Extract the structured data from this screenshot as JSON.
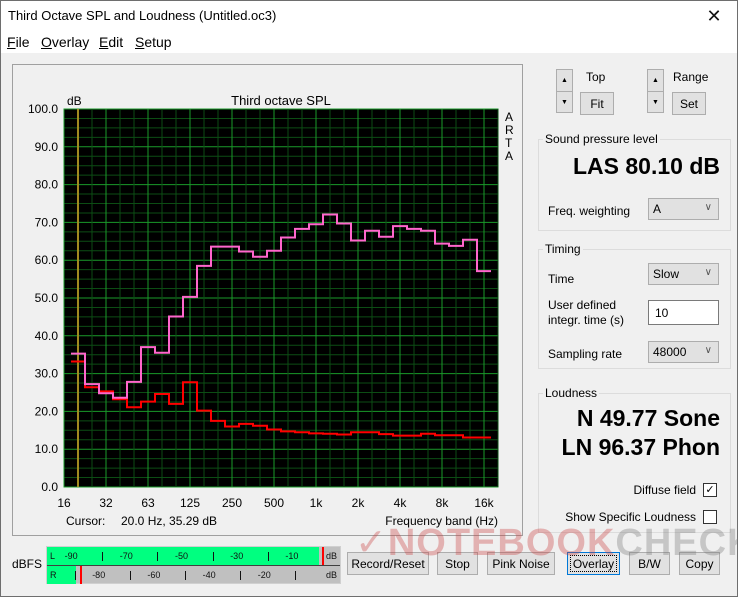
{
  "window": {
    "title": "Third Octave SPL and Loudness (Untitled.oc3)",
    "close_icon": "close-x-icon"
  },
  "menu": [
    {
      "label": "File",
      "mnemonic": "F",
      "rest": "ile"
    },
    {
      "label": "Overlay",
      "mnemonic": "O",
      "rest": "verlay"
    },
    {
      "label": "Edit",
      "mnemonic": "E",
      "rest": "dit"
    },
    {
      "label": "Setup",
      "mnemonic": "S",
      "rest": "etup"
    }
  ],
  "controls": {
    "top_label": "Top",
    "fit_button": "Fit",
    "range_label": "Range",
    "set_button": "Set",
    "spin_up_icon": "triangle-up-icon",
    "spin_down_icon": "triangle-down-icon"
  },
  "spl": {
    "group_label": "Sound pressure level",
    "value": "LAS 80.10 dB",
    "freq_weighting_label": "Freq. weighting",
    "freq_weighting_value": "A"
  },
  "timing": {
    "group_label": "Timing",
    "time_label": "Time",
    "time_value": "Slow",
    "integr_label_1": "User defined",
    "integr_label_2": "integr. time (s)",
    "integr_value": "10",
    "sampling_label": "Sampling rate",
    "sampling_value": "48000"
  },
  "loudness": {
    "group_label": "Loudness",
    "sone": "N 49.77 Sone",
    "phon": "LN 96.37 Phon",
    "diffuse_label": "Diffuse field",
    "diffuse_checked": true,
    "specific_label": "Show Specific Loudness",
    "specific_checked": false,
    "check_mark": "✓"
  },
  "meter": {
    "label": "dBFS",
    "top_ticks": [
      "-90",
      "-70",
      "-50",
      "-30",
      "-10"
    ],
    "bottom_ticks": [
      "-80",
      "-60",
      "-40",
      "-20"
    ],
    "unit": "dB",
    "channel_l": "L",
    "channel_r": "R",
    "l_level_dbfs": -1.5,
    "l_peak_dbfs": -0.2,
    "r_level_dbfs": -89.5,
    "r_peak_dbfs": -88.0,
    "range": [
      -100,
      0
    ],
    "fill_color": "#00ff80",
    "peak_color": "#ff0000"
  },
  "buttons": {
    "record_reset": "Record/Reset",
    "stop": "Stop",
    "pink_noise": "Pink Noise",
    "overlay": "Overlay",
    "bw": "B/W",
    "copy": "Copy"
  },
  "watermark": {
    "part1": "✓NOTEBOOK",
    "part2": "CHECK"
  },
  "chart_data": {
    "type": "line",
    "title": "Third octave SPL",
    "ylabel": "dB",
    "xlabel": "Frequency band (Hz)",
    "side_label": [
      "A",
      "R",
      "T",
      "A"
    ],
    "ylim": [
      0,
      100
    ],
    "yticks": [
      "0.0",
      "10.0",
      "20.0",
      "30.0",
      "40.0",
      "50.0",
      "60.0",
      "70.0",
      "80.0",
      "90.0",
      "100.0"
    ],
    "xtick_labels": [
      "16",
      "32",
      "63",
      "125",
      "250",
      "500",
      "1k",
      "2k",
      "4k",
      "8k",
      "16k"
    ],
    "x_band_range": [
      "16",
      "20k"
    ],
    "grid": true,
    "background": "#000000",
    "grid_color_major": "#1a9a2a",
    "grid_color_minor": "#0c4d14",
    "cursor": {
      "text_label": "Cursor:",
      "text_value": "20.0 Hz, 35.29 dB",
      "freq": 20,
      "color": "#a08a20"
    },
    "bands": [
      "20",
      "25",
      "31.5",
      "40",
      "50",
      "63",
      "80",
      "100",
      "125",
      "160",
      "200",
      "250",
      "315",
      "400",
      "500",
      "630",
      "800",
      "1k",
      "1.25k",
      "1.6k",
      "2k",
      "2.5k",
      "3.15k",
      "4k",
      "5k",
      "6.3k",
      "8k",
      "10k",
      "12.5k",
      "16k"
    ],
    "series": [
      {
        "name": "current",
        "color": "#ff66cc",
        "values": [
          35.3,
          27.2,
          24.8,
          23.6,
          27.8,
          37.0,
          35.5,
          45.1,
          50.3,
          58.5,
          63.6,
          63.6,
          62.3,
          60.9,
          62.5,
          66.0,
          68.3,
          69.5,
          72.1,
          69.7,
          65.2,
          67.8,
          66.2,
          69.0,
          68.3,
          67.8,
          64.4,
          63.8,
          65.4,
          57.1
        ]
      },
      {
        "name": "overlay",
        "color": "#ff0000",
        "values": [
          33.2,
          26.4,
          25.3,
          23.2,
          21.1,
          22.6,
          24.6,
          22.0,
          27.7,
          20.2,
          17.5,
          16.0,
          16.7,
          16.2,
          15.2,
          14.7,
          14.5,
          14.2,
          14.1,
          13.9,
          14.5,
          14.5,
          14.0,
          13.6,
          13.6,
          14.1,
          13.7,
          13.7,
          13.1,
          13.1
        ]
      }
    ]
  }
}
